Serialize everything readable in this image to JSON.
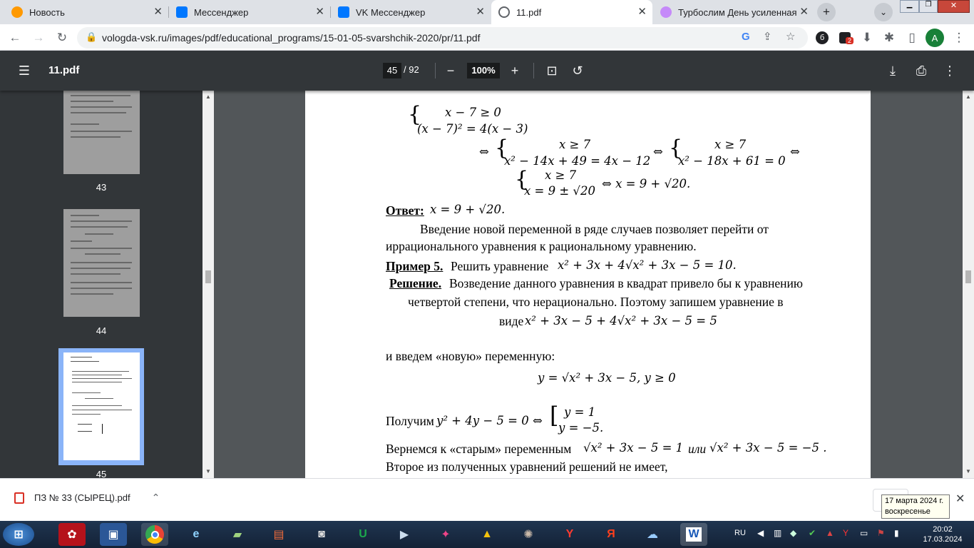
{
  "tabs": [
    {
      "title": "Новость",
      "color": "#ff9900",
      "active": false
    },
    {
      "title": "Мессенджер",
      "color": "#0077ff",
      "active": false
    },
    {
      "title": "VK Мессенджер",
      "color": "#0077ff",
      "active": false
    },
    {
      "title": "11.pdf",
      "color": "#5f6368",
      "active": true
    },
    {
      "title": "Турбослим День усиленная ф",
      "color": "#a142f4",
      "active": false
    }
  ],
  "omnibox": {
    "url": "vologda-vsk.ru/images/pdf/educational_programs/15-01-05-svarshchik-2020/pr/11.pdf"
  },
  "profile_initial": "A",
  "ext_badge": "2",
  "pdf": {
    "filename": "11.pdf",
    "page": "45",
    "total": "/ 92",
    "zoom": "100%"
  },
  "sidebar": {
    "thumbs": [
      {
        "label": "43"
      },
      {
        "label": "44"
      },
      {
        "label": "45"
      }
    ]
  },
  "doc": {
    "sys1_a": "x − 7 ≥ 0",
    "sys1_b": "(x − 7)² = 4(x − 3)",
    "eq_iff1": "⇔",
    "sys2_a": "x ≥ 7",
    "sys2_b": "x² − 14x + 49 = 4x − 12",
    "eq_iff2": "⇔",
    "sys3_a": "x ≥ 7",
    "sys3_b": "x² − 18x + 61 = 0",
    "eq_iff3": "⇔",
    "sys4_a": "x ≥ 7",
    "sys4_b": "x = 9 ± √20",
    "sys4_tail": "⇔ x = 9 + √20.",
    "answer_label": "Ответ:",
    "answer_value": "x = 9 + √20.",
    "para1_l1": "Введение новой переменной в ряде случаев позволяет перейти от",
    "para1_l2": "иррационального уравнения к рациональному уравнению.",
    "ex_label": "Пример 5.",
    "ex_text": "Решить уравнение",
    "ex_eq": "x² + 3x + 4√x² + 3x − 5 = 10.",
    "sol_label": "Решение.",
    "sol_l1": "Возведение данного уравнения в квадрат привело бы к уравнению",
    "sol_l2": "четвертой степени, что нерационально. Поэтому запишем уравнение в",
    "sol_l3_word": "виде",
    "sol_l3_eq": "x² + 3x − 5 + 4√x² + 3x − 5 = 5",
    "intro_l": "и введем «новую» переменную:",
    "sub_eq": "y = √x² + 3x − 5, y ≥ 0",
    "got_word": "Получим",
    "got_eq": "y² + 4y − 5 = 0 ⇔",
    "got_c1": "y = 1",
    "got_c2": "y = −5.",
    "back_word": "Вернемся к «старым» переменным",
    "back_eq1": "√x² + 3x − 5 = 1",
    "back_or": "или",
    "back_eq2": "√x² + 3x − 5 = −5 .",
    "last_l": "Второе из полученных уравнений решений не имеет,"
  },
  "download": {
    "name": "ПЗ № 33 (СЫРЕЦ).pdf"
  },
  "tooltip": {
    "line1": "17 марта 2024 г.",
    "line2": "воскресенье"
  },
  "tray": {
    "lang": "RU",
    "time": "20:02",
    "date": "17.03.2024"
  }
}
